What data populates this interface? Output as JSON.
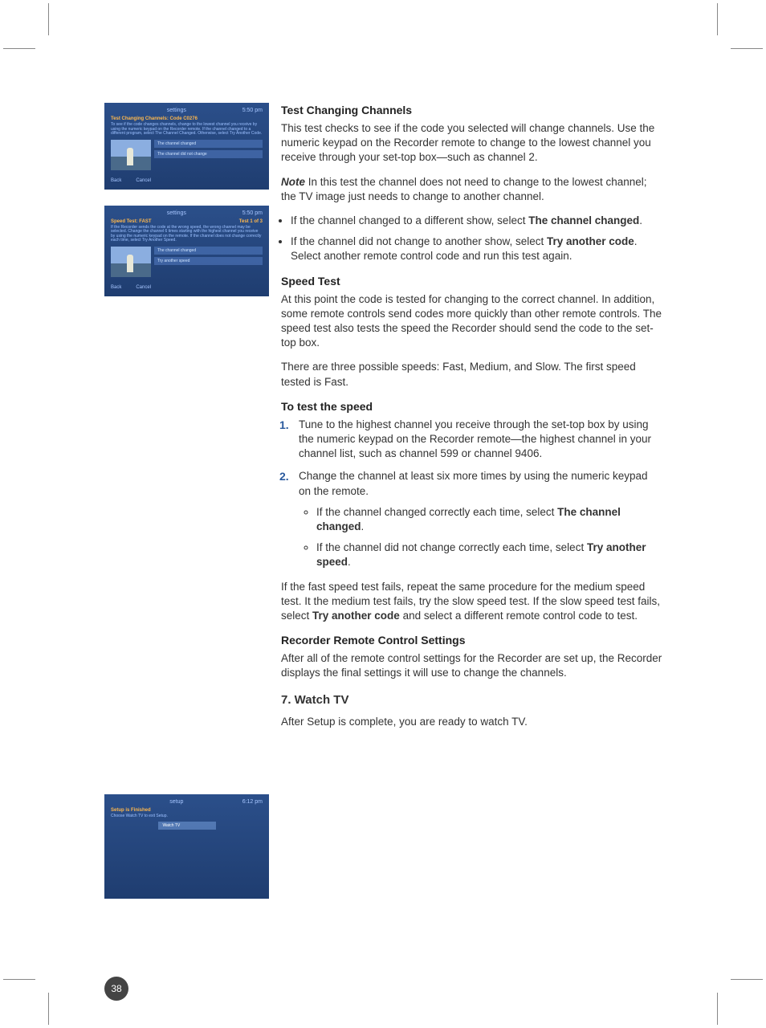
{
  "page_number": "38",
  "sidebar": {
    "shot1": {
      "topbar": "settings",
      "time": "5:50 pm",
      "title": "Test Changing Channels: Code C0276",
      "desc": "To see if the code changes channels, change to the lowest channel you receive by using the numeric keypad on the Recorder remote. If the channel changed to a different program, select The Channel Changed. Otherwise, select Try Another Code.",
      "opt1": "The channel changed",
      "opt2": "The channel did not change",
      "back": "Back",
      "cancel": "Cancel"
    },
    "shot2": {
      "topbar": "settings",
      "time": "5:50 pm",
      "title": "Speed Test: FAST",
      "test": "Test 1 of 3",
      "desc": "If the Recorder sends the code at the wrong speed, the wrong channel may be selected. Change the channel 6 times starting with the highest channel you receive by using the numeric keypad on the remote. If the channel does not change correctly each time, select Try Another Speed.",
      "opt1": "The channel changed",
      "opt2": "Try another speed",
      "back": "Back",
      "cancel": "Cancel"
    },
    "shot3": {
      "topbar": "setup",
      "time": "6:12 pm",
      "title": "Setup is Finished",
      "desc": "Choose Watch TV to exit Setup.",
      "btn": "Watch TV"
    }
  },
  "main": {
    "h1": "Test Changing Channels",
    "p1": "This test checks to see if the code you selected will change channels. Use the numeric keypad on the Recorder remote to change to the lowest channel you receive through your set-top box—such as channel 2.",
    "note_label": "Note",
    "note": "   In this test the channel does not need to change to the lowest channel; the TV image just needs to change to another channel.",
    "bullet1a": "If the channel changed to a different show, select ",
    "bullet1b": "The channel changed",
    "bullet1c": ".",
    "bullet2a": "If the channel did not change to another show, select ",
    "bullet2b": "Try another code",
    "bullet2c": ". Select another remote control code and run this test again.",
    "h2": "Speed Test",
    "p2": "At this point the code is tested for changing to the correct channel. In addition, some remote controls send codes more quickly than other remote controls. The speed test also tests the speed the Recorder should send the code to the set-top box.",
    "p3": "There are three possible speeds: Fast, Medium, and Slow. The first speed tested is Fast.",
    "h3": "To test the speed",
    "ol1": "Tune to the highest channel you receive through the set-top box by using the numeric keypad on the Recorder remote—the highest channel in your channel list, such as channel 599 or channel 9406.",
    "ol2": "Change the channel at least six more times by using the numeric keypad on the remote.",
    "ol2_b1a": "If the channel changed correctly each time, select ",
    "ol2_b1b": "The channel changed",
    "ol2_b1c": ".",
    "ol2_b2a": "If the channel did not change correctly each time, select ",
    "ol2_b2b": "Try another speed",
    "ol2_b2c": ".",
    "p4a": "If the fast speed test fails, repeat the same procedure for the medium speed test. It the medium test fails, try the slow speed test. If the slow speed test fails, select ",
    "p4b": "Try another code",
    "p4c": " and select a different remote control code to test.",
    "h4": "Recorder Remote Control Settings",
    "p5": "After all of the remote control settings for the Recorder are set up, the Recorder displays the final settings it will use to change the channels.",
    "h5": "7. Watch TV",
    "p6": "After Setup is complete, you are ready to watch TV."
  }
}
